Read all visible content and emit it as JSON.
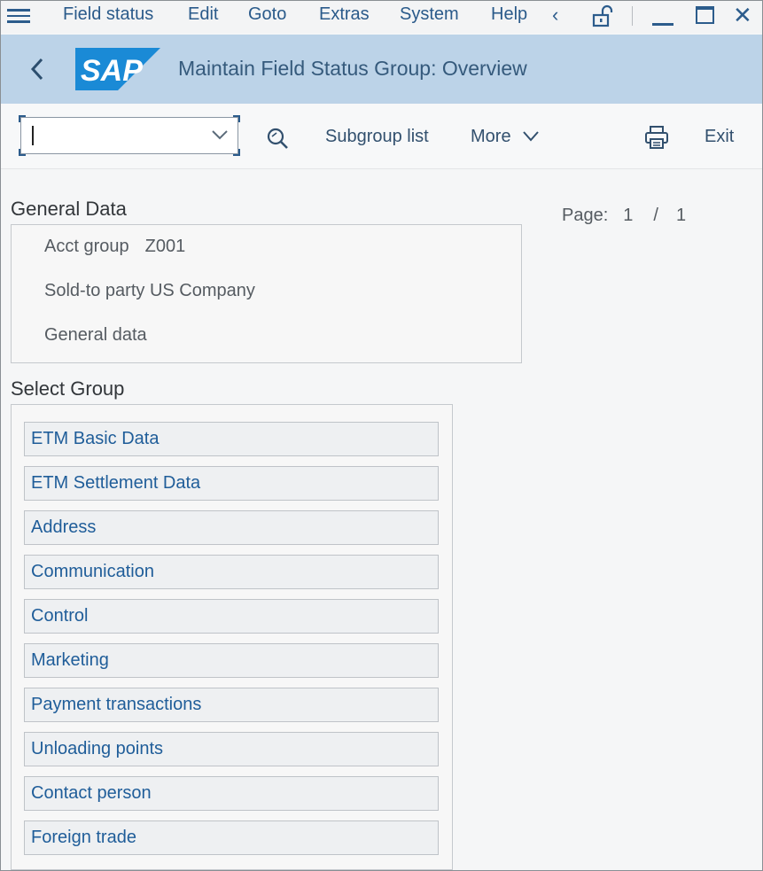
{
  "menu": {
    "items": [
      {
        "label": "Field status"
      },
      {
        "label": "Edit"
      },
      {
        "label": "Goto"
      },
      {
        "label": "Extras"
      },
      {
        "label": "System"
      },
      {
        "label": "Help"
      }
    ]
  },
  "header": {
    "logo_text": "SAP",
    "title": "Maintain Field Status Group: Overview",
    "colors": {
      "bar": "#bcd3e8",
      "logo": "#1a8ad6"
    }
  },
  "toolbar": {
    "command_value": "",
    "subgroup_list_label": "Subgroup list",
    "more_label": "More",
    "exit_label": "Exit"
  },
  "general": {
    "title": "General Data",
    "acct_group_label": "Acct group",
    "acct_group_value": "Z001",
    "line2": "Sold-to party US Company",
    "line3": "General data"
  },
  "paging": {
    "label": "Page:",
    "current": "1",
    "separator": "/",
    "total": "1"
  },
  "select_group": {
    "title": "Select Group",
    "items": [
      {
        "label": "ETM Basic Data"
      },
      {
        "label": "ETM Settlement Data"
      },
      {
        "label": "Address"
      },
      {
        "label": "Communication"
      },
      {
        "label": "Control"
      },
      {
        "label": "Marketing"
      },
      {
        "label": "Payment transactions"
      },
      {
        "label": "Unloading points"
      },
      {
        "label": "Contact person"
      },
      {
        "label": "Foreign trade"
      }
    ]
  }
}
